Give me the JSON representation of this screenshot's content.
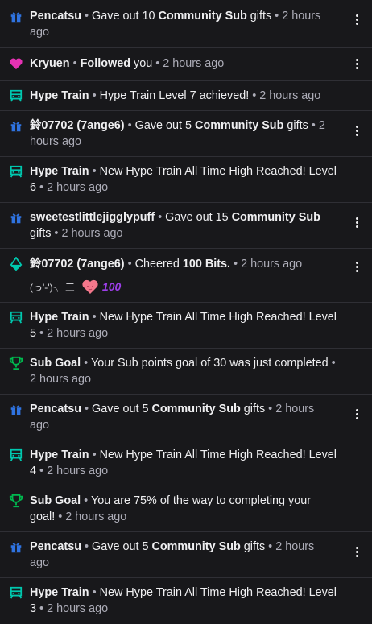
{
  "colors": {
    "background": "#18181b",
    "divider": "#2f2f35",
    "gift_icon": "#2f73e0",
    "heart_icon": "#e632b4",
    "train_icon": "#00c8af",
    "goal_icon": "#00b94f",
    "cheer_icon": "#00c8af",
    "cheer_amount": "#9c3ee8"
  },
  "sep": "•",
  "events": [
    {
      "icon": "gift-icon",
      "user": "Pencatsu",
      "pre": "Gave out 10 ",
      "bold": "Community Sub",
      "post": " gifts",
      "time": "2 hours ago"
    },
    {
      "icon": "heart-icon",
      "user": "Kryuen",
      "pre": "",
      "bold": "Followed",
      "post": " you",
      "time": "2 hours ago"
    },
    {
      "icon": "hype-train-icon",
      "user": "Hype Train",
      "pre": "Hype Train Level 7 achieved!",
      "bold": "",
      "post": "",
      "time": "2 hours ago"
    },
    {
      "icon": "gift-icon",
      "user": "鈴07702 (7ange6)",
      "pre": "Gave out 5 ",
      "bold": "Community Sub",
      "post": " gifts",
      "time": "2 hours ago"
    },
    {
      "icon": "hype-train-icon",
      "user": "Hype Train",
      "pre": "New Hype Train All Time High Reached! Level 6",
      "bold": "",
      "post": "",
      "time": "2 hours ago"
    },
    {
      "icon": "gift-icon",
      "user": "sweetestlittlejigglypuff",
      "pre": "Gave out 15 ",
      "bold": "Community Sub",
      "post": " gifts",
      "time": "2 hours ago"
    },
    {
      "icon": "cheer-icon",
      "user": "鈴07702 (7ange6)",
      "pre": "Cheered ",
      "bold": "100 Bits.",
      "post": "",
      "time": "2 hours ago",
      "message": "(っ'-')╮ 三",
      "cheer_amount": "100"
    },
    {
      "icon": "hype-train-icon",
      "user": "Hype Train",
      "pre": "New Hype Train All Time High Reached! Level 5",
      "bold": "",
      "post": "",
      "time": "2 hours ago"
    },
    {
      "icon": "trophy-icon",
      "user": "Sub Goal",
      "pre": "Your Sub points goal of 30 was just completed",
      "bold": "",
      "post": "",
      "time": "2 hours ago"
    },
    {
      "icon": "gift-icon",
      "user": "Pencatsu",
      "pre": "Gave out 5 ",
      "bold": "Community Sub",
      "post": " gifts",
      "time": "2 hours ago"
    },
    {
      "icon": "hype-train-icon",
      "user": "Hype Train",
      "pre": "New Hype Train All Time High Reached! Level 4",
      "bold": "",
      "post": "",
      "time": "2 hours ago"
    },
    {
      "icon": "trophy-icon",
      "user": "Sub Goal",
      "pre": "You are 75% of the way to completing your goal!",
      "bold": "",
      "post": "",
      "time": "2 hours ago"
    },
    {
      "icon": "gift-icon",
      "user": "Pencatsu",
      "pre": "Gave out 5 ",
      "bold": "Community Sub",
      "post": " gifts",
      "time": "2 hours ago"
    },
    {
      "icon": "hype-train-icon",
      "user": "Hype Train",
      "pre": "New Hype Train All Time High Reached! Level 3",
      "bold": "",
      "post": "",
      "time": "2 hours ago"
    }
  ]
}
